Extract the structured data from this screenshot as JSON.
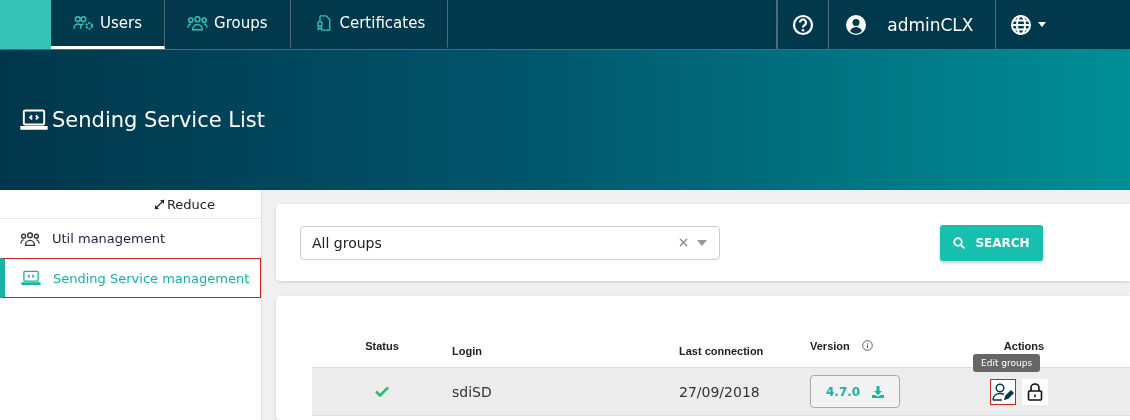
{
  "nav": {
    "tabs": [
      {
        "label": "Users",
        "selected": true
      },
      {
        "label": "Groups",
        "selected": false
      },
      {
        "label": "Certificates",
        "selected": false
      }
    ],
    "user": "adminCLX"
  },
  "header": {
    "title": "Sending Service List"
  },
  "sidebar": {
    "reduce": "Reduce",
    "items": [
      {
        "label": "Util management",
        "selected": false
      },
      {
        "label": "Sending Service management",
        "selected": true
      }
    ]
  },
  "filter": {
    "value": "All groups",
    "search_button": "SEARCH"
  },
  "table": {
    "columns": [
      "Status",
      "Login",
      "Last connection",
      "Version",
      "Actions"
    ],
    "rows": [
      {
        "status_ok": true,
        "login": "sdiSD",
        "last_connection": "27/09/2018",
        "version": "4.7.0"
      }
    ],
    "tooltip": "Edit groups"
  }
}
